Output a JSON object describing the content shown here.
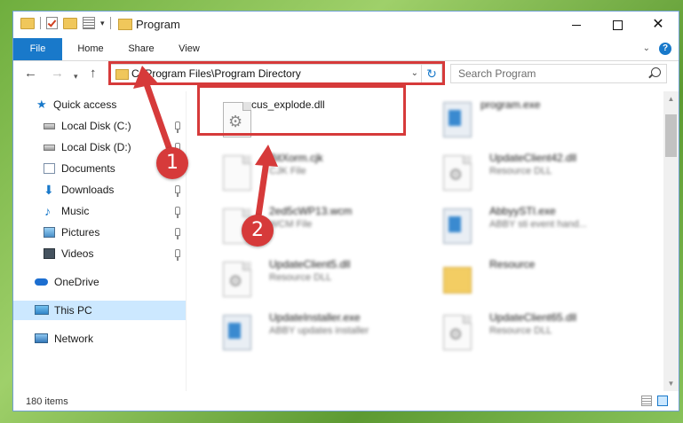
{
  "window": {
    "title": "Program"
  },
  "window_controls": {
    "minimize": "—",
    "maximize": "☐",
    "close": "✕"
  },
  "ribbon": {
    "tabs": [
      "File",
      "Home",
      "Share",
      "View"
    ],
    "help": "?"
  },
  "nav": {
    "address": "C:\\Program Files\\Program Directory",
    "search_placeholder": "Search Program"
  },
  "sidebar": {
    "items": [
      {
        "label": "Quick access",
        "icon": "star-icon"
      },
      {
        "label": "Local Disk (C:)",
        "icon": "disk-icon"
      },
      {
        "label": "Local Disk (D:)",
        "icon": "disk-icon"
      },
      {
        "label": "Documents",
        "icon": "documents-icon"
      },
      {
        "label": "Downloads",
        "icon": "download-icon"
      },
      {
        "label": "Music",
        "icon": "music-icon"
      },
      {
        "label": "Pictures",
        "icon": "pictures-icon"
      },
      {
        "label": "Videos",
        "icon": "videos-icon"
      },
      {
        "label": "OneDrive",
        "icon": "onedrive-icon"
      },
      {
        "label": "This PC",
        "icon": "pc-icon"
      },
      {
        "label": "Network",
        "icon": "network-icon"
      }
    ]
  },
  "files": [
    {
      "name": "cus_explode.dll",
      "type": ""
    },
    {
      "name": "program.exe",
      "type": ""
    },
    {
      "name": "BitXorm.cjk",
      "type": "CJK File"
    },
    {
      "name": "UpdateClient42.dll",
      "type": "Resource DLL"
    },
    {
      "name": "2ed5cWP13.wcm",
      "type": "WCM File"
    },
    {
      "name": "AbbyySTI.exe",
      "type": "ABBY sti event hand..."
    },
    {
      "name": "UpdateClient5.dll",
      "type": "Resource DLL"
    },
    {
      "name": "Resource",
      "type": ""
    },
    {
      "name": "UpdateInstaller.exe",
      "type": "ABBY updates installer"
    },
    {
      "name": "UpdateClient65.dll",
      "type": "Resource DLL"
    }
  ],
  "status": {
    "item_count": "180 items"
  },
  "annotations": {
    "marker1": "1",
    "marker2": "2"
  },
  "colors": {
    "accent": "#1979ca",
    "highlight": "#d63a3a",
    "selected": "#cce8ff"
  }
}
